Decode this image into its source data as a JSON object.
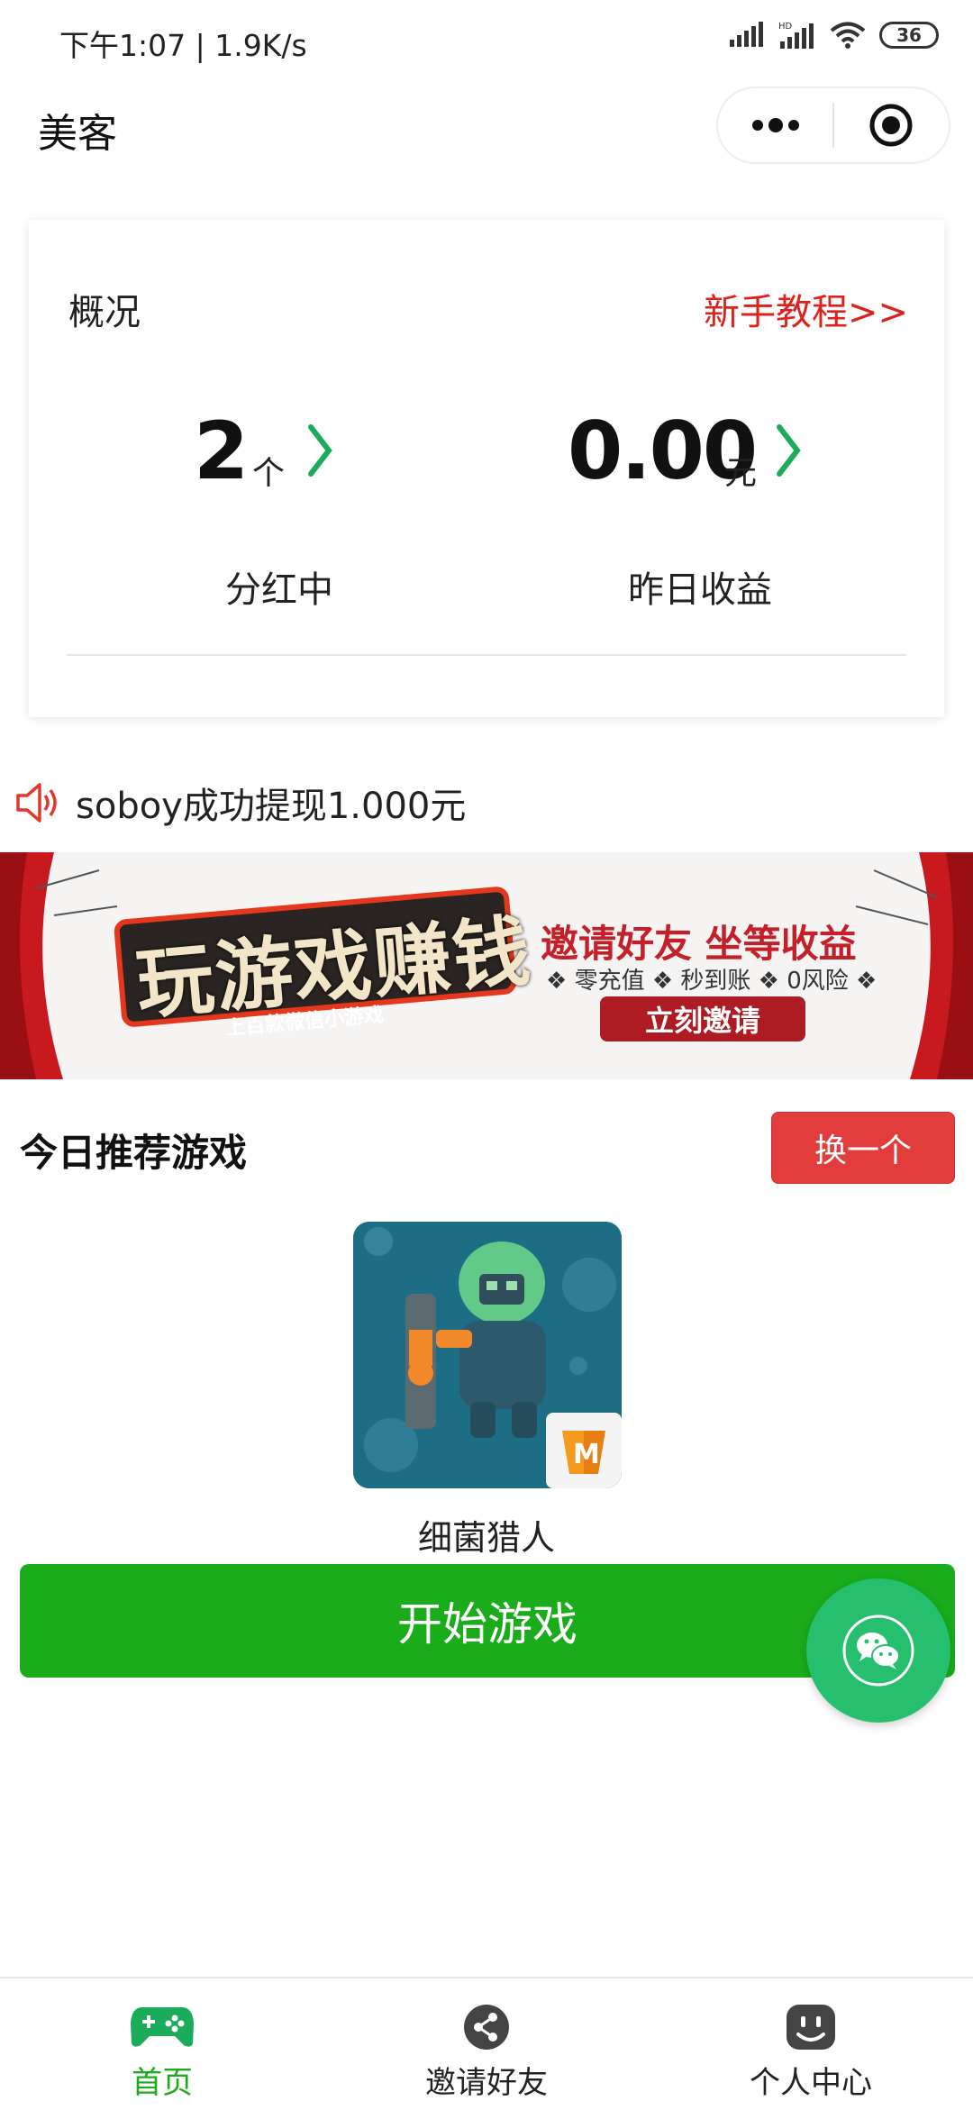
{
  "status_bar": {
    "time": "下午1:07 | 1.9K/s",
    "battery": "36"
  },
  "nav": {
    "title": "美客"
  },
  "overview": {
    "title": "概况",
    "tutorial_link": "新手教程>>",
    "stats": [
      {
        "value": "2",
        "unit": "个",
        "label": "分红中"
      },
      {
        "value": "0.00",
        "unit": "元",
        "label": "昨日收益"
      }
    ]
  },
  "notice": {
    "text": "soboy成功提现1.000元"
  },
  "banner": {
    "title": "玩游戏赚钱",
    "subtitle": "上百款微信小游戏",
    "headline": "邀请好友  坐等收益",
    "features": "❖ 零充值 ❖ 秒到账 ❖ 0风险 ❖",
    "button": "立刻邀请"
  },
  "recommend": {
    "title": "今日推荐游戏",
    "swap_button": "换一个",
    "game_name": "细菌猎人",
    "start_button": "开始游戏"
  },
  "tabs": [
    {
      "label": "首页",
      "icon": "gamepad-icon",
      "active": true
    },
    {
      "label": "邀请好友",
      "icon": "share-icon",
      "active": false
    },
    {
      "label": "个人中心",
      "icon": "profile-icon",
      "active": false
    }
  ],
  "colors": {
    "accent_green": "#1aac1a",
    "link_red": "#e0201a",
    "swap_red": "#e23c3c",
    "float_green": "#25bf6e"
  }
}
